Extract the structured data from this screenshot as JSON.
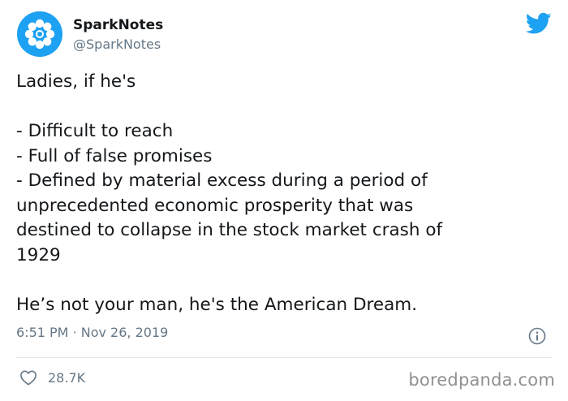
{
  "author": {
    "display_name": "SparkNotes",
    "handle": "@SparkNotes",
    "avatar_icon": "sparknotes-logo-icon",
    "avatar_color": "#1da1f2"
  },
  "platform_icon": "twitter-bird-icon",
  "tweet": {
    "line1": "Ladies, if he's",
    "item1": "- Difficult to reach",
    "item2": "- Full of false promises",
    "item3_l1": "- Defined by material excess during a period of",
    "item3_l2": "unprecedented economic prosperity that was",
    "item3_l3": "destined to collapse in the stock market crash of",
    "item3_l4": "1929",
    "closing": "He’s not your man, he's the American Dream."
  },
  "timestamp": "6:51 PM · Nov 26, 2019",
  "info_icon": "info-icon",
  "likes": {
    "icon": "heart-icon",
    "count": "28.7K"
  },
  "watermark": "boredpanda.com",
  "colors": {
    "accent": "#1da1f2",
    "text": "#14171a",
    "secondary": "#657786",
    "divider": "#e1e8ed"
  }
}
